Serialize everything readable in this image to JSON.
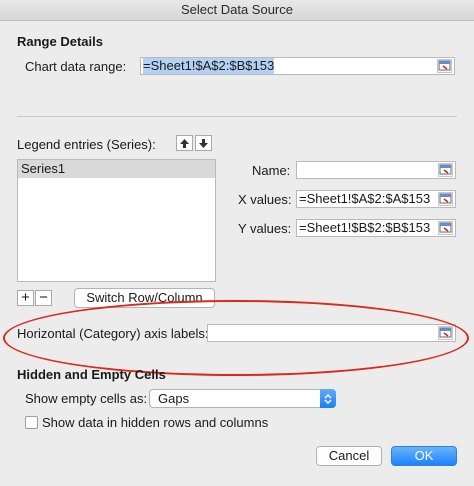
{
  "window": {
    "title": "Select Data Source"
  },
  "range_details": {
    "heading": "Range Details",
    "chart_data_range_label": "Chart data range:",
    "chart_data_range_value": "=Sheet1!$A$2:$B$153"
  },
  "legend": {
    "heading": "Legend entries (Series):",
    "series": [
      "Series1"
    ],
    "add_symbol": "+",
    "remove_symbol": "−",
    "switch_label": "Switch Row/Column"
  },
  "series_fields": {
    "name_label": "Name:",
    "name_value": "",
    "x_label": "X values:",
    "x_value": "=Sheet1!$A$2:$A$153",
    "y_label": "Y values:",
    "y_value": "=Sheet1!$B$2:$B$153"
  },
  "axis": {
    "label": "Horizontal (Category) axis labels:",
    "value": ""
  },
  "hidden_empty": {
    "heading": "Hidden and Empty Cells",
    "show_empty_label": "Show empty cells as:",
    "show_empty_value": "Gaps",
    "show_hidden_label": "Show data in hidden rows and columns",
    "show_hidden_checked": false
  },
  "buttons": {
    "cancel": "Cancel",
    "ok": "OK"
  },
  "colors": {
    "accent": "#1a82fb",
    "annotation": "#d92a1c",
    "selection": "#b3d1f5"
  },
  "icons": {
    "range_picker": "range-picker-icon",
    "move_up": "arrow-up-icon",
    "move_down": "arrow-down-icon",
    "dropdown": "chevron-updown-icon"
  }
}
